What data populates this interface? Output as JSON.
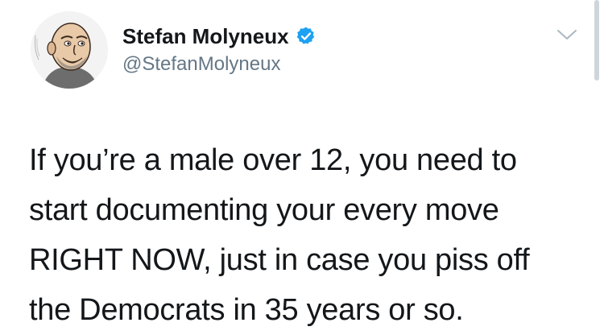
{
  "author": {
    "display_name": "Stefan Molyneux",
    "handle": "@StefanMolyneux",
    "verified": true
  },
  "tweet": {
    "lines": [
      "If you’re a male over 12, you need to",
      "start documenting your every move",
      "RIGHT NOW, just in case you piss off",
      "the Democrats in 35 years or so."
    ]
  },
  "icons": {
    "avatar": "caricature-avatar",
    "verified": "verified-badge-icon",
    "menu": "chevron-down-icon"
  },
  "colors": {
    "verified_blue": "#1da1f2",
    "handle_gray": "#657786",
    "text": "#14171a"
  }
}
